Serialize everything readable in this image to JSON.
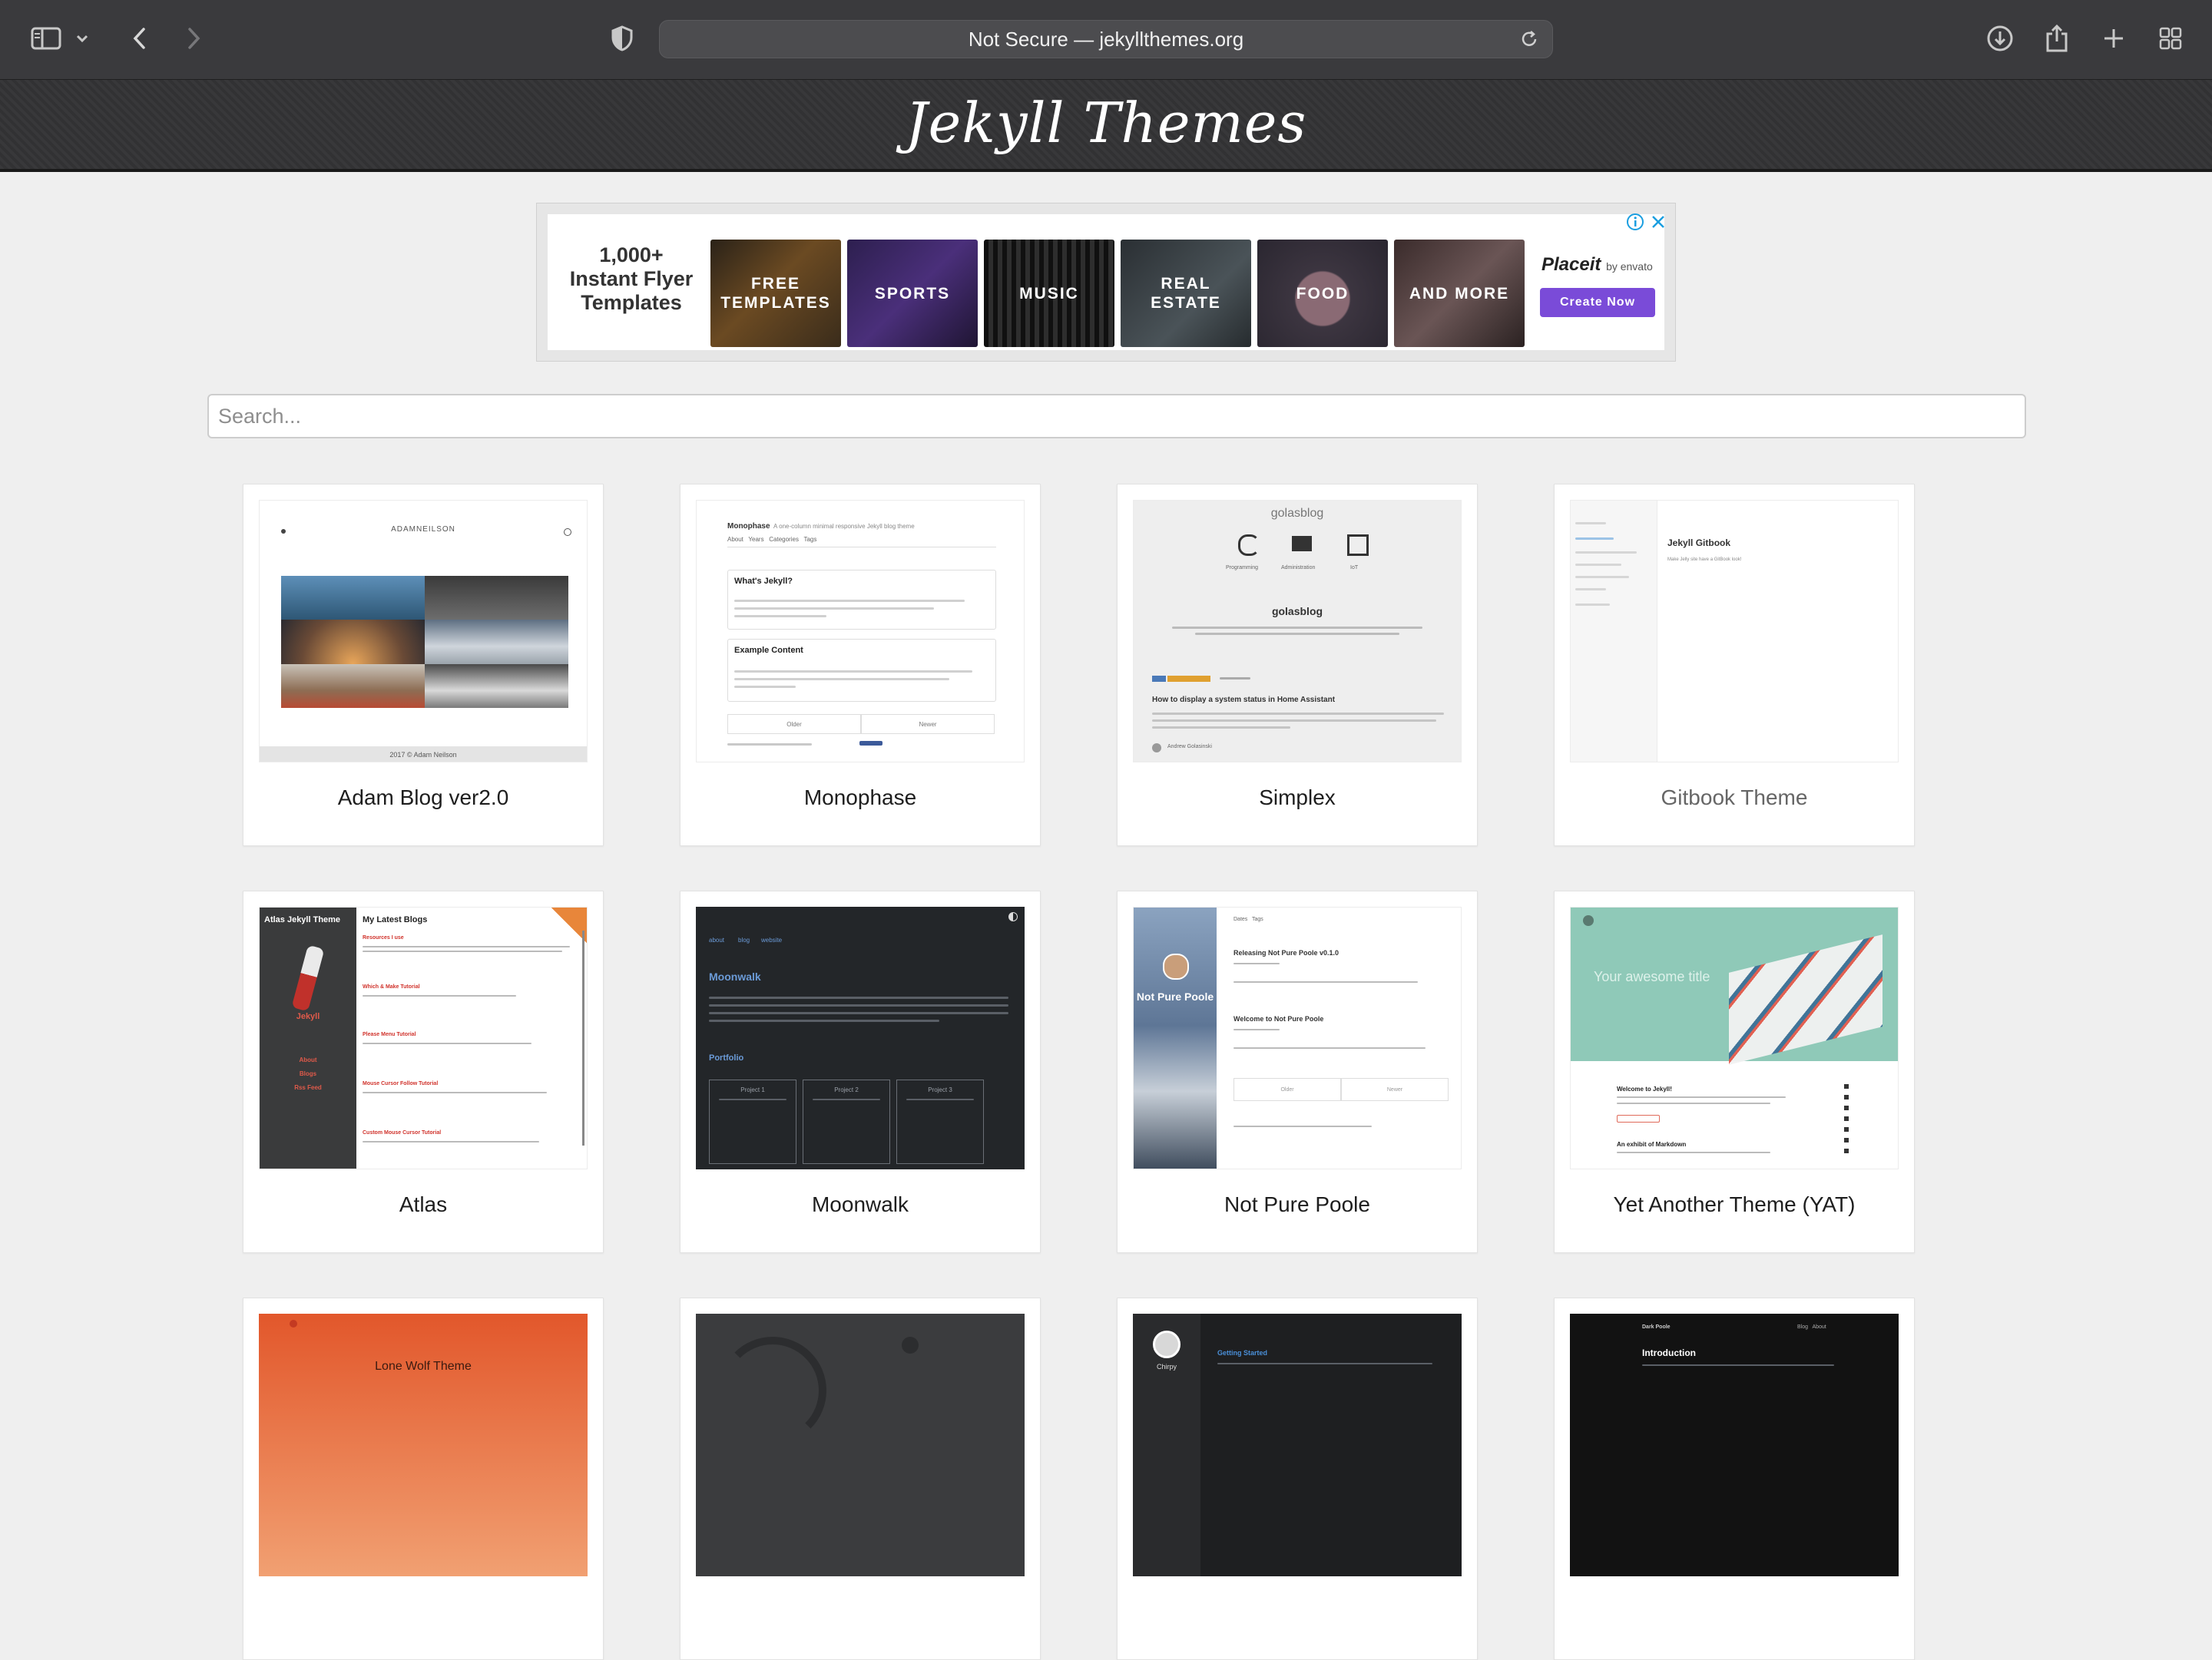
{
  "browser": {
    "address": "Not Secure — jekyllthemes.org"
  },
  "site": {
    "logo": "Jekyll Themes"
  },
  "ad": {
    "headline": "1,000+ Instant Flyer Templates",
    "tiles": [
      "FREE TEMPLATES",
      "SPORTS",
      "MUSIC",
      "REAL ESTATE",
      "FOOD",
      "AND MORE"
    ],
    "brand": "Placeit",
    "brand_by": "by envato",
    "cta": "Create Now"
  },
  "search": {
    "placeholder": "Search..."
  },
  "themes": [
    {
      "title": "Adam Blog ver2.0"
    },
    {
      "title": "Monophase"
    },
    {
      "title": "Simplex"
    },
    {
      "title": "Gitbook Theme"
    },
    {
      "title": "Atlas"
    },
    {
      "title": "Moonwalk"
    },
    {
      "title": "Not Pure Poole"
    },
    {
      "title": "Yet Another Theme (YAT)"
    }
  ],
  "thumbs": {
    "adam": {
      "brand": "ADAMNEILSON",
      "footer": "2017 © Adam Neilson"
    },
    "mono": {
      "brand": "Monophase",
      "tagline": "A one-column minimal responsive Jekyll blog theme",
      "nav": "About   Years   Categories   Tags",
      "post1": "What's Jekyll?",
      "post2": "Example Content",
      "older": "Older",
      "newer": "Newer"
    },
    "simplex": {
      "site": "golasblog",
      "heading": "golasblog",
      "icon1": "Programming",
      "icon2": "Administration",
      "icon3": "IoT",
      "post": "How to display a system status in Home Assistant",
      "author": "Andrew Golasinski"
    },
    "gitbook": {
      "heading": "Jekyll Gitbook",
      "sub": "Make Jelly site have a GitBook look!"
    },
    "atlas": {
      "side_title": "Atlas Jekyll Theme",
      "main_title": "My Latest Blogs",
      "brand": "Jekyll",
      "links": [
        "About",
        "Blogs",
        "Rss Feed"
      ],
      "posts": [
        "Resources I use",
        "Which & Make Tutorial",
        "Please Menu Tutorial",
        "Mouse Cursor Follow Tutorial",
        "Custom Mouse Cursor Tutorial"
      ]
    },
    "moonwalk": {
      "nav": [
        "about",
        "blog",
        "website"
      ],
      "heading": "Moonwalk",
      "section": "Portfolio",
      "projects": [
        "Project 1",
        "Project 2",
        "Project 3"
      ]
    },
    "poole": {
      "name": "Not Pure Poole",
      "nav": "Dates   Tags",
      "post1": "Releasing Not Pure Poole v0.1.0",
      "post2": "Welcome to Not Pure Poole",
      "older": "Older",
      "newer": "Newer"
    },
    "yat": {
      "hero": "Your awesome title",
      "post1": "Welcome to Jekyll!",
      "post2": "An exhibit of Markdown"
    },
    "lonewolf": {
      "title": "Lone Wolf Theme"
    },
    "chirpy": {
      "name": "Chirpy",
      "post": "Getting Started"
    },
    "darkpoole": {
      "brand": "Dark Poole",
      "nav": "Blog   About",
      "post": "Introduction"
    }
  }
}
